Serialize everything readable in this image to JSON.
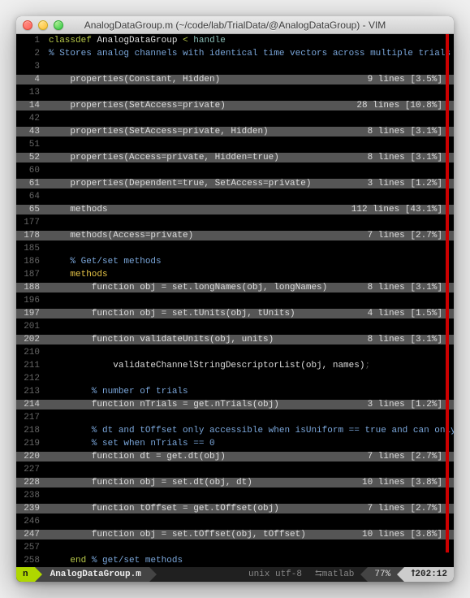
{
  "window": {
    "title": "AnalogDataGroup.m (~/code/lab/TrialData/@AnalogDataGroup) - VIM"
  },
  "lines": [
    {
      "n": "1",
      "type": "code",
      "html": "<span class='kw'>classdef</span> <span class='str'>AnalogDataGroup</span> <span class='kw'>&lt;</span> <span class='blue'>handle</span>"
    },
    {
      "n": "2",
      "type": "comment",
      "text": "% Stores analog channels with identical time vectors across multiple trials"
    },
    {
      "n": "3",
      "type": "blank"
    },
    {
      "n": "4",
      "type": "fold",
      "left": "    properties(Constant, Hidden)",
      "right": "9 lines [3.5%]"
    },
    {
      "n": "13",
      "type": "blank"
    },
    {
      "n": "14",
      "type": "fold",
      "left": "    properties(SetAccess=private)",
      "right": "28 lines [10.8%]"
    },
    {
      "n": "42",
      "type": "blank"
    },
    {
      "n": "43",
      "type": "fold",
      "left": "    properties(SetAccess=private, Hidden)",
      "right": "8 lines [3.1%]"
    },
    {
      "n": "51",
      "type": "blank"
    },
    {
      "n": "52",
      "type": "fold",
      "left": "    properties(Access=private, Hidden=true)",
      "right": "8 lines [3.1%]"
    },
    {
      "n": "60",
      "type": "blank"
    },
    {
      "n": "61",
      "type": "fold",
      "left": "    properties(Dependent=true, SetAccess=private)",
      "right": "3 lines [1.2%]"
    },
    {
      "n": "64",
      "type": "blank"
    },
    {
      "n": "65",
      "type": "fold",
      "left": "    methods",
      "right": "112 lines [43.1%]"
    },
    {
      "n": "177",
      "type": "blank"
    },
    {
      "n": "178",
      "type": "fold",
      "left": "    methods(Access=private)",
      "right": "7 lines [2.7%]"
    },
    {
      "n": "185",
      "type": "blank"
    },
    {
      "n": "186",
      "type": "comment",
      "text": "    % Get/set methods"
    },
    {
      "n": "187",
      "type": "code",
      "html": "    <span class='kw2'>methods</span>"
    },
    {
      "n": "188",
      "type": "fold",
      "left": "        function obj = set.longNames(obj, longNames)",
      "right": "8 lines [3.1%]"
    },
    {
      "n": "196",
      "type": "blank"
    },
    {
      "n": "197",
      "type": "fold",
      "left": "        function obj = set.tUnits(obj, tUnits)",
      "right": "4 lines [1.5%]"
    },
    {
      "n": "201",
      "type": "blank"
    },
    {
      "n": "202",
      "type": "fold",
      "left": "        function validateUnits(obj, units)",
      "right": "8 lines [3.1%]"
    },
    {
      "n": "210",
      "type": "blank"
    },
    {
      "n": "211",
      "type": "code",
      "html": "            validateChannelStringDescriptorList(obj, names)<span class='faint'>;</span>"
    },
    {
      "n": "212",
      "type": "blank"
    },
    {
      "n": "213",
      "type": "comment",
      "text": "        % number of trials"
    },
    {
      "n": "214",
      "type": "fold",
      "left": "        function nTrials = get.nTrials(obj)",
      "right": "3 lines [1.2%]"
    },
    {
      "n": "217",
      "type": "blank"
    },
    {
      "n": "218",
      "type": "comment",
      "text": "        % dt and tOffset only accessible when isUniform == true and can only be"
    },
    {
      "n": "219",
      "type": "comment",
      "text": "        % set when nTrials == 0"
    },
    {
      "n": "220",
      "type": "fold",
      "left": "        function dt = get.dt(obj)",
      "right": "7 lines [2.7%]"
    },
    {
      "n": "227",
      "type": "blank"
    },
    {
      "n": "228",
      "type": "fold",
      "left": "        function obj = set.dt(obj, dt)",
      "right": "10 lines [3.8%]"
    },
    {
      "n": "238",
      "type": "blank"
    },
    {
      "n": "239",
      "type": "fold",
      "left": "        function tOffset = get.tOffset(obj)",
      "right": "7 lines [2.7%]"
    },
    {
      "n": "246",
      "type": "blank"
    },
    {
      "n": "247",
      "type": "fold",
      "left": "        function obj = set.tOffset(obj, tOffset)",
      "right": "10 lines [3.8%]"
    },
    {
      "n": "257",
      "type": "blank"
    },
    {
      "n": "258",
      "type": "code",
      "html": "    <span class='kw'>end</span> <span class='cmt'>% get/set methods</span>"
    }
  ],
  "status": {
    "mode": "n",
    "filename": "AnalogDataGroup.m",
    "encoding": "unix utf-8",
    "filetype": "matlab",
    "percent": "77%",
    "position": "202:12"
  }
}
